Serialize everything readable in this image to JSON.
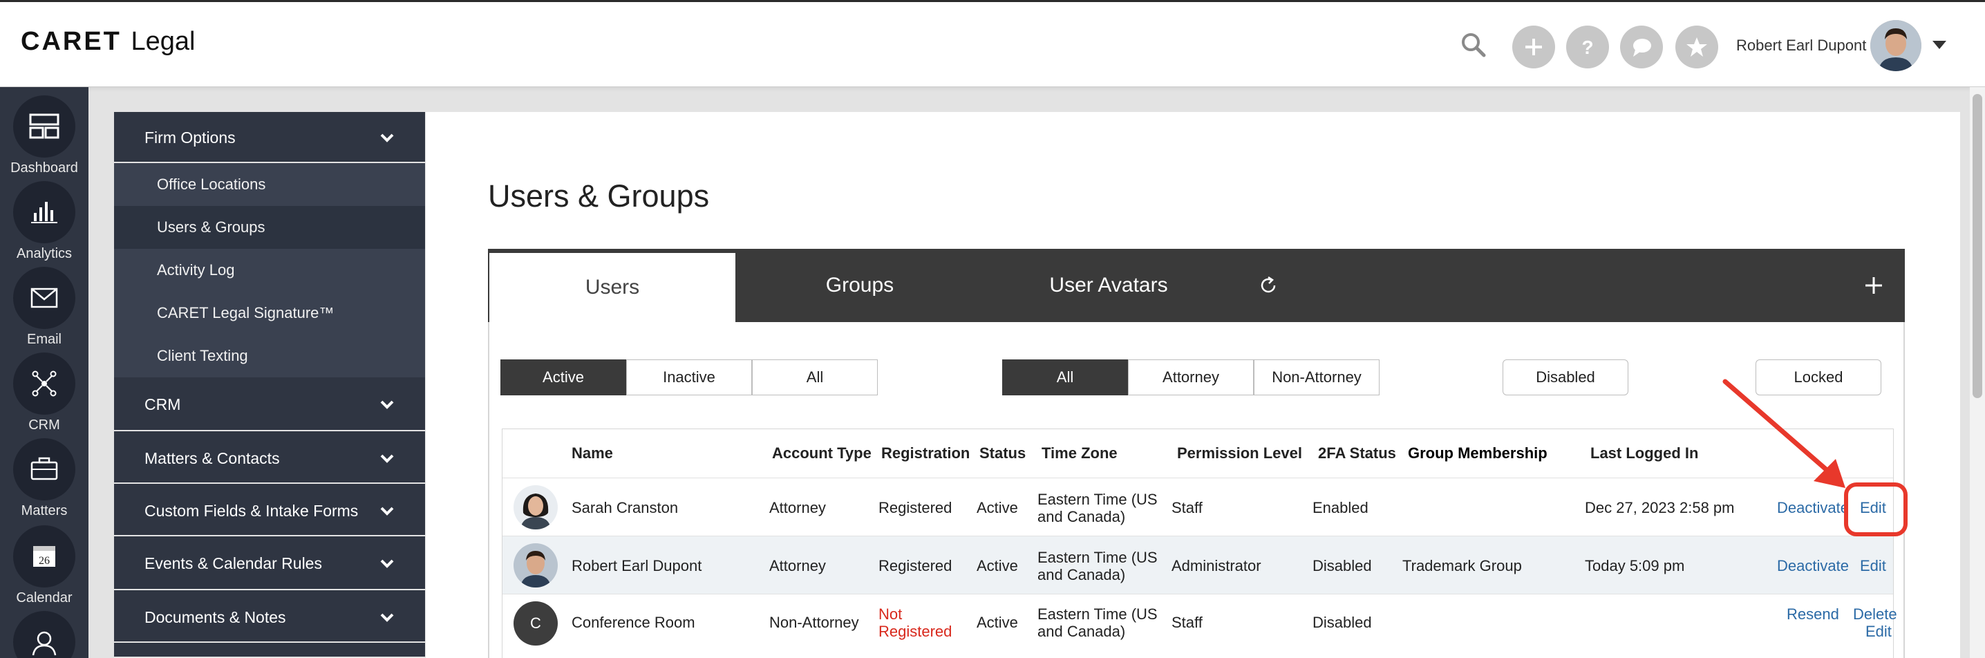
{
  "app": {
    "logo_text": "CARET",
    "logo_suffix": "Legal"
  },
  "header": {
    "user_name": "Robert Earl Dupont",
    "icons": [
      "search-icon",
      "plus-icon",
      "help-icon",
      "chat-icon",
      "star-icon"
    ]
  },
  "iconnav": {
    "items": [
      {
        "label": "Dashboard",
        "icon": "dashboard-icon"
      },
      {
        "label": "Analytics",
        "icon": "analytics-icon"
      },
      {
        "label": "Email",
        "icon": "email-icon"
      },
      {
        "label": "CRM",
        "icon": "crm-icon"
      },
      {
        "label": "Matters",
        "icon": "briefcase-icon"
      },
      {
        "label": "Calendar",
        "icon": "calendar-icon",
        "day": "26"
      },
      {
        "label": "",
        "icon": "contacts-icon"
      }
    ]
  },
  "settings": {
    "firm_options": "Firm Options",
    "sub_items": [
      "Office Locations",
      "Users & Groups",
      "Activity Log",
      "CARET Legal Signature™",
      "Client Texting"
    ],
    "groups": [
      "CRM",
      "Matters & Contacts",
      "Custom Fields & Intake Forms",
      "Events & Calendar Rules",
      "Documents & Notes"
    ]
  },
  "main": {
    "title": "Users & Groups",
    "tabs": [
      "Users",
      "Groups",
      "User Avatars"
    ],
    "status_filters": [
      "Active",
      "Inactive",
      "All"
    ],
    "type_filters": [
      "All",
      "Attorney",
      "Non-Attorney"
    ],
    "disabled_label": "Disabled",
    "locked_label": "Locked"
  },
  "table": {
    "headers": [
      "Name",
      "Account Type",
      "Registration",
      "Status",
      "Time Zone",
      "Permission Level",
      "2FA Status",
      "Group Membership",
      "Last Logged In"
    ],
    "rows": [
      {
        "name": "Sarah Cranston",
        "account_type": "Attorney",
        "registration": "Registered",
        "status": "Active",
        "tz1": "Eastern Time (US",
        "tz2": "and Canada)",
        "permission": "Staff",
        "twofa": "Enabled",
        "group": "",
        "last_login": "Dec 27, 2023 2:58 pm",
        "action1": "Deactivate",
        "action2": "Edit"
      },
      {
        "name": "Robert Earl Dupont",
        "account_type": "Attorney",
        "registration": "Registered",
        "status": "Active",
        "tz1": "Eastern Time (US",
        "tz2": "and Canada)",
        "permission": "Administrator",
        "twofa": "Disabled",
        "group": "Trademark Group",
        "last_login": "Today 5:09 pm",
        "action1": "Deactivate",
        "action2": "Edit"
      },
      {
        "initial": "C",
        "name": "Conference Room",
        "account_type": "Non-Attorney",
        "registration1": "Not",
        "registration2": "Registered",
        "status": "Active",
        "tz1": "Eastern Time (US",
        "tz2": "and Canada)",
        "permission": "Staff",
        "twofa": "Disabled",
        "group": "",
        "last_login": "",
        "action1": "Resend",
        "action2": "Delete",
        "action3": "Edit"
      }
    ]
  },
  "colors": {
    "nav_dark": "#2f3542",
    "tabbar": "#3a3a3a",
    "link": "#2b6aa6",
    "annotation": "#e8382b",
    "not_registered": "#d8281c"
  }
}
